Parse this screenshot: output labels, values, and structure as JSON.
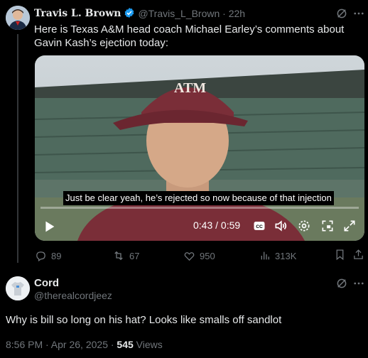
{
  "tweet": {
    "author_name": "Travis L. Brown",
    "handle": "@Travis_L_Brown",
    "time": "22h",
    "text": "Here is Texas A&M head coach Michael Earley’s comments about Gavin Kash’s ejection today:",
    "video": {
      "subtitle": "Just be clear yeah, he’s rejected so now because of that injection",
      "time_display": "0:43 / 0:59",
      "progress": 0.0
    },
    "actions": {
      "replies": "89",
      "reposts": "67",
      "likes": "950",
      "views": "313K"
    }
  },
  "reply": {
    "author_name": "Cord",
    "handle": "@therealcordjeez",
    "text": "Why is bill so long on his hat? Looks like smalls off sandlot",
    "timestamp": "8:56 PM · Apr 26, 2025 · ",
    "views_count": "545",
    "views_label": " Views"
  },
  "colors": {
    "background": "#000000",
    "text": "#e7e9ea",
    "muted": "#71767b",
    "verified": "#1d9bf0",
    "hat": "#7a2e38"
  },
  "icons": [
    "verified-badge-icon",
    "grok-icon",
    "more-icon",
    "play-icon",
    "captions-icon",
    "volume-icon",
    "settings-icon",
    "pip-icon",
    "fullscreen-icon",
    "reply-icon",
    "repost-icon",
    "like-icon",
    "views-icon",
    "bookmark-icon",
    "share-icon"
  ]
}
